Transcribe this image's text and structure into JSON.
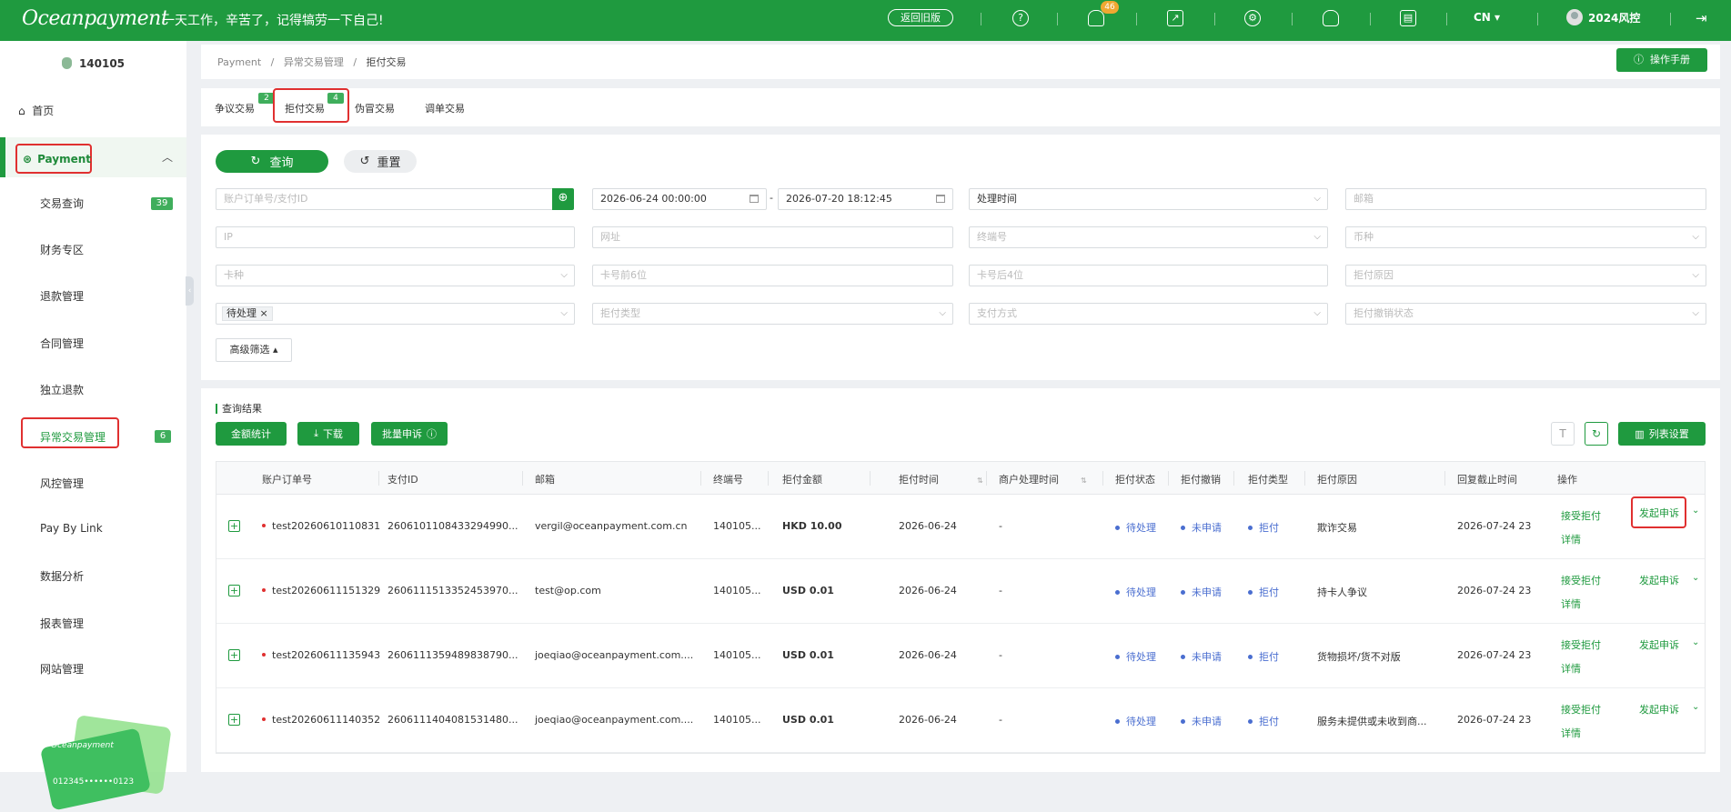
{
  "header": {
    "logo": "Oceanpayment",
    "slogan": "一天工作，辛苦了，记得犒劳一下自己!",
    "old_version": "返回旧版",
    "notification_count": "46",
    "language": "CN",
    "user": "2024风控"
  },
  "sidebar": {
    "merchant_id": "140105",
    "home": "首页",
    "payment": "Payment",
    "items": [
      {
        "label": "交易查询",
        "badge": "39"
      },
      {
        "label": "财务专区",
        "badge": ""
      },
      {
        "label": "退款管理",
        "badge": ""
      },
      {
        "label": "合同管理",
        "badge": ""
      },
      {
        "label": "独立退款",
        "badge": ""
      },
      {
        "label": "异常交易管理",
        "badge": "6"
      },
      {
        "label": "风控管理",
        "badge": ""
      },
      {
        "label": "Pay By Link",
        "badge": ""
      },
      {
        "label": "数据分析",
        "badge": ""
      },
      {
        "label": "报表管理",
        "badge": ""
      },
      {
        "label": "网站管理",
        "badge": ""
      }
    ],
    "card_brand": "Oceanpayment",
    "card_number": "012345••••••0123"
  },
  "breadcrumb": {
    "a": "Payment",
    "b": "异常交易管理",
    "c": "拒付交易"
  },
  "manual_button": "操作手册",
  "tabs": [
    {
      "label": "争议交易",
      "badge": "2"
    },
    {
      "label": "拒付交易",
      "badge": "4"
    },
    {
      "label": "伪冒交易",
      "badge": ""
    },
    {
      "label": "调单交易",
      "badge": ""
    }
  ],
  "filters": {
    "search_button": "查询",
    "reset_button": "重置",
    "order_placeholder": "账户订单号/支付ID",
    "date_start": "2026-06-24 00:00:00",
    "date_sep": "-",
    "date_end": "2026-07-20 18:12:45",
    "time_type": "处理时间",
    "email_placeholder": "邮箱",
    "ip_placeholder": "IP",
    "url_placeholder": "网址",
    "terminal_placeholder": "终端号",
    "currency_placeholder": "币种",
    "card_type_placeholder": "卡种",
    "card_first6_placeholder": "卡号前6位",
    "card_last4_placeholder": "卡号后4位",
    "reason_placeholder": "拒付原因",
    "status_tag": "待处理",
    "cb_type_placeholder": "拒付类型",
    "pay_method_placeholder": "支付方式",
    "revoke_placeholder": "拒付撤销状态",
    "advanced": "高级筛选"
  },
  "results": {
    "title": "查询结果",
    "amount_stats": "金额统计",
    "download": "下载",
    "batch_appeal": "批量申诉",
    "column_settings": "列表设置",
    "columns": [
      "账户订单号",
      "支付ID",
      "邮箱",
      "终端号",
      "拒付金额",
      "拒付时间",
      "商户处理时间",
      "拒付状态",
      "拒付撤销",
      "拒付类型",
      "拒付原因",
      "回复截止时间",
      "操作"
    ],
    "rows": [
      {
        "order": "test20260610110831",
        "pay_id": "2606101108433294990...",
        "email": "vergil@oceanpayment.com.cn",
        "terminal": "140105...",
        "amount": "HKD 10.00",
        "cb_time": "2026-06-24",
        "merchant_time": "-",
        "status": "待处理",
        "revoke": "未申请",
        "type": "拒付",
        "reason": "欺诈交易",
        "deadline": "2026-07-24 23",
        "accept": "接受拒付",
        "appeal": "发起申诉",
        "detail": "详情"
      },
      {
        "order": "test20260611151329",
        "pay_id": "2606111513352453970...",
        "email": "test@op.com",
        "terminal": "140105...",
        "amount": "USD 0.01",
        "cb_time": "2026-06-24",
        "merchant_time": "-",
        "status": "待处理",
        "revoke": "未申请",
        "type": "拒付",
        "reason": "持卡人争议",
        "deadline": "2026-07-24 23",
        "accept": "接受拒付",
        "appeal": "发起申诉",
        "detail": "详情"
      },
      {
        "order": "test20260611135943",
        "pay_id": "2606111359489838790...",
        "email": "joeqiao@oceanpayment.com....",
        "terminal": "140105...",
        "amount": "USD 0.01",
        "cb_time": "2026-06-24",
        "merchant_time": "-",
        "status": "待处理",
        "revoke": "未申请",
        "type": "拒付",
        "reason": "货物损坏/货不对版",
        "deadline": "2026-07-24 23",
        "accept": "接受拒付",
        "appeal": "发起申诉",
        "detail": "详情"
      },
      {
        "order": "test20260611140352",
        "pay_id": "2606111404081531480...",
        "email": "joeqiao@oceanpayment.com....",
        "terminal": "140105...",
        "amount": "USD 0.01",
        "cb_time": "2026-06-24",
        "merchant_time": "-",
        "status": "待处理",
        "revoke": "未申请",
        "type": "拒付",
        "reason": "服务未提供或未收到商...",
        "deadline": "2026-07-24 23",
        "accept": "接受拒付",
        "appeal": "发起申诉",
        "detail": "详情"
      }
    ]
  },
  "colors": {
    "brand": "#1f9a3f",
    "highlight": "#e03030",
    "status": "#4a6ed0"
  }
}
